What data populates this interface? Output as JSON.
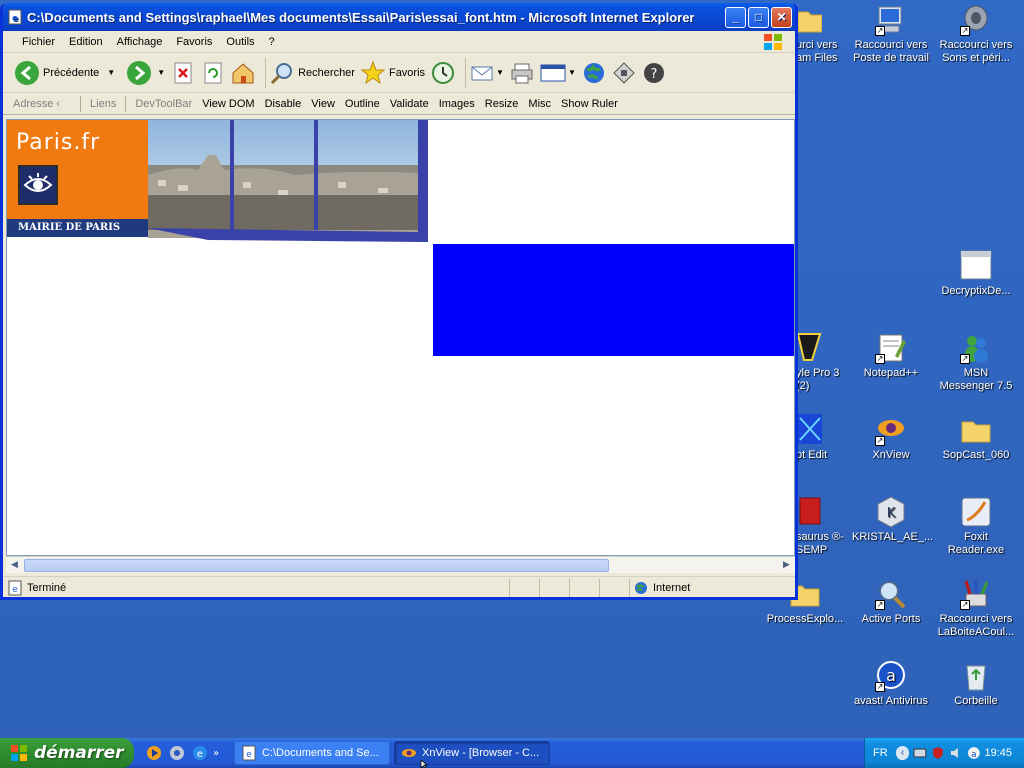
{
  "window": {
    "title": "C:\\Documents and Settings\\raphael\\Mes documents\\Essai\\Paris\\essai_font.htm - Microsoft Internet Explorer",
    "minimize": "_",
    "maximize": "□",
    "close": "✕"
  },
  "menu": {
    "items": [
      "Fichier",
      "Edition",
      "Affichage",
      "Favoris",
      "Outils",
      "?"
    ]
  },
  "toolbar": {
    "back_label": "Précédente",
    "search_label": "Rechercher",
    "favorites_label": "Favoris"
  },
  "linksbar": {
    "address_label": "Adresse",
    "links_label": "Liens",
    "devtoolbar_label": "DevToolBar",
    "items": [
      "View DOM",
      "Disable",
      "View",
      "Outline",
      "Validate",
      "Images",
      "Resize",
      "Misc",
      "Show Ruler"
    ]
  },
  "page": {
    "logo_text": "Paris.fr",
    "logo_caption": "MAIRIE DE PARIS"
  },
  "status": {
    "text": "Terminé",
    "zone": "Internet"
  },
  "desktop": {
    "icons": [
      {
        "label": "urci vers\nam Files"
      },
      {
        "label": "Raccourci vers Poste de travail"
      },
      {
        "label": "Raccourci vers Sons et péri..."
      },
      {
        "label": "DecryptixDe..."
      },
      {
        "label": "yle Pro 3 (2)"
      },
      {
        "label": "Notepad++"
      },
      {
        "label": "MSN Messenger 7.5"
      },
      {
        "label": "pt Edit"
      },
      {
        "label": "XnView"
      },
      {
        "label": "SopCast_060"
      },
      {
        "label": "saurus ®-SEMP"
      },
      {
        "label": "KRISTAL_AE_..."
      },
      {
        "label": "Foxit Reader.exe"
      },
      {
        "label": "ProcessExplo..."
      },
      {
        "label": "Active Ports"
      },
      {
        "label": "Raccourci vers LaBoiteACoul..."
      },
      {
        "label": "avast! Antivirus"
      },
      {
        "label": "Corbeille"
      }
    ]
  },
  "taskbar": {
    "start_label": "démarrer",
    "tasks": [
      {
        "label": "C:\\Documents and Se..."
      },
      {
        "label": "XnView - [Browser - C..."
      }
    ],
    "lang": "FR",
    "clock": "19:45"
  },
  "colors": {
    "desktop": "#3169c6",
    "titlebar": "#0b47d0",
    "paris_orange": "#f07a10",
    "blue_block": "#0000ff"
  }
}
